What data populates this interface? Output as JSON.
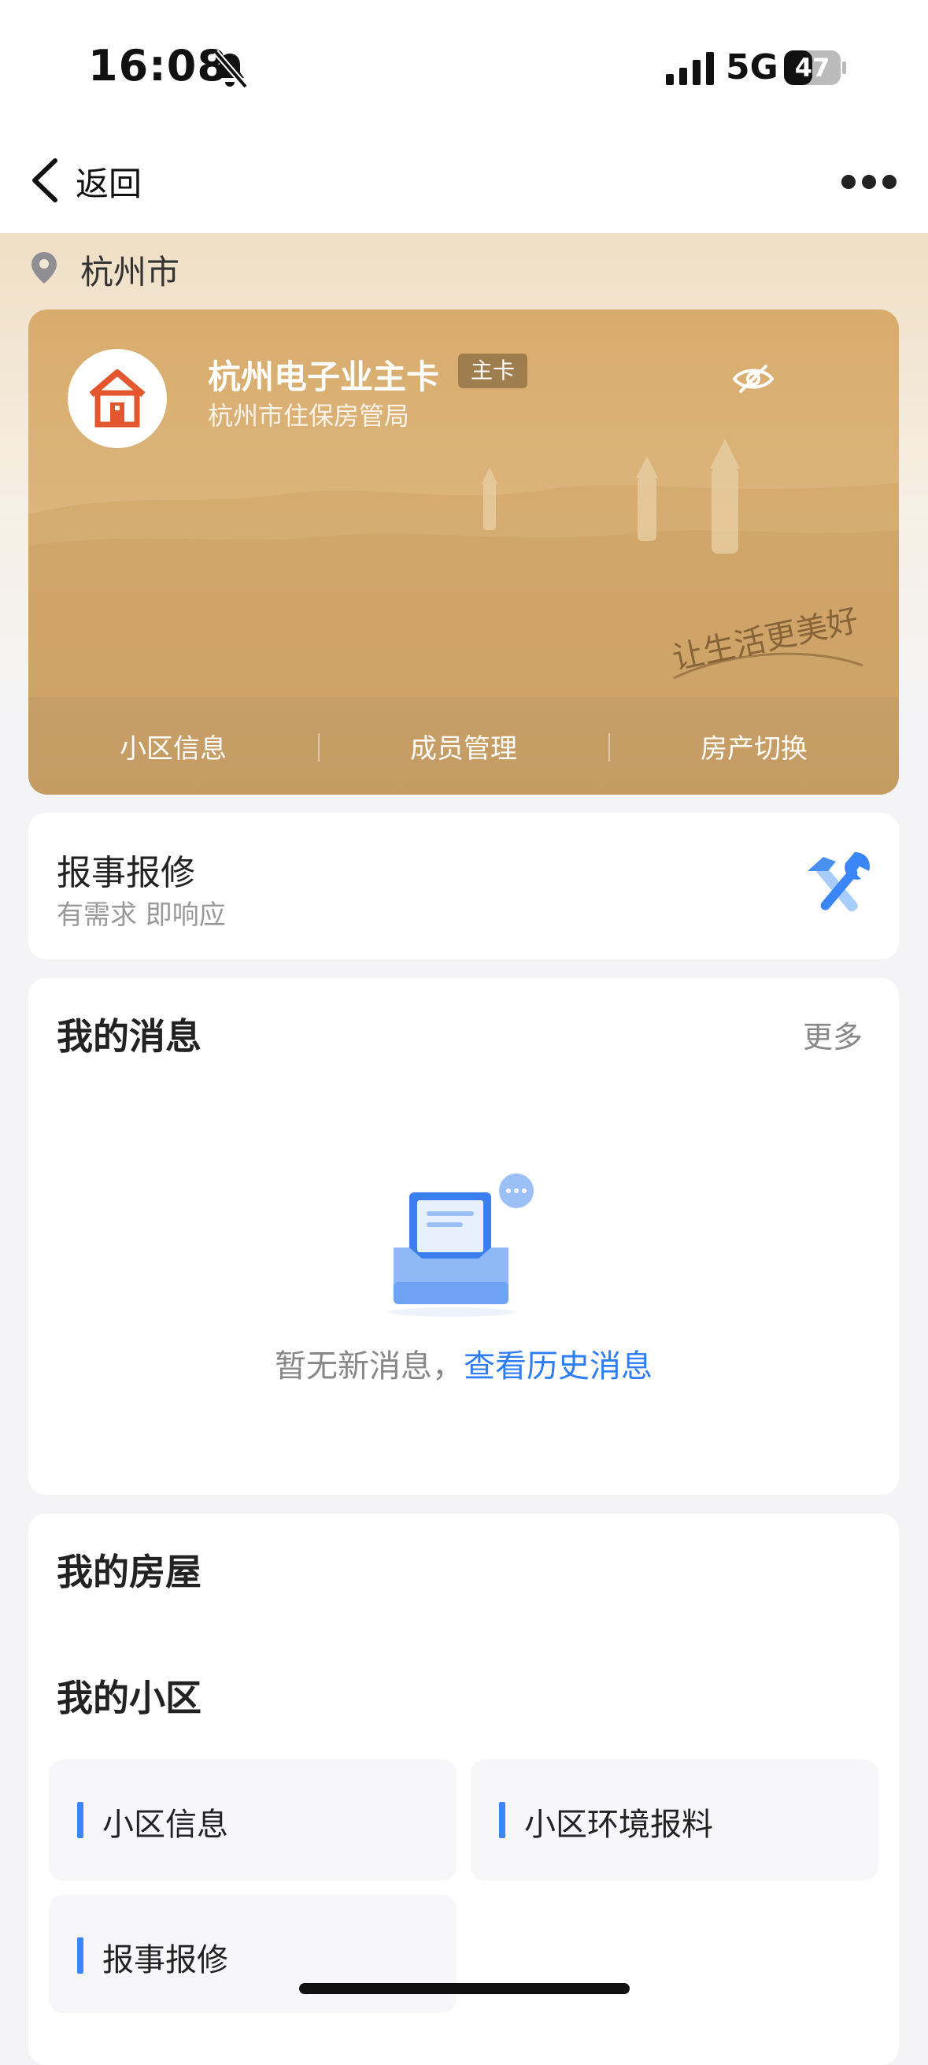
{
  "status_bar": {
    "time": "16:08",
    "network": "5G",
    "battery": "47"
  },
  "nav": {
    "back_label": "返回"
  },
  "location": {
    "city": "杭州市"
  },
  "card": {
    "title": "杭州电子业主卡",
    "badge": "主卡",
    "issuer": "杭州市住保房管局",
    "tabs": [
      "小区信息",
      "成员管理",
      "房产切换"
    ]
  },
  "repair": {
    "title": "报事报修",
    "subtitle": "有需求 即响应"
  },
  "messages": {
    "title": "我的消息",
    "more": "更多",
    "empty_text": "暂无新消息，",
    "history_link": "查看历史消息"
  },
  "house": {
    "title": "我的房屋",
    "community_title": "我的小区",
    "items": [
      "小区信息",
      "小区环境报料",
      "报事报修"
    ]
  },
  "colors": {
    "accent": "#2f7df6",
    "card": "#d8ac6c",
    "logo": "#e4572e"
  }
}
